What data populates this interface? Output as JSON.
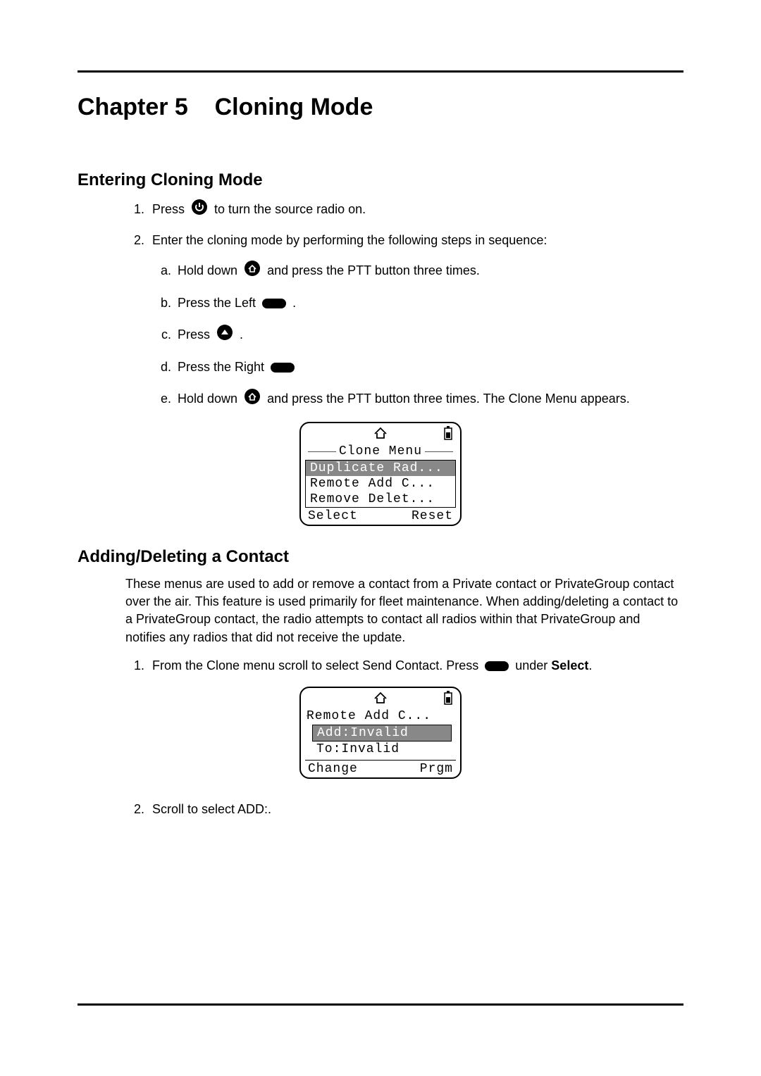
{
  "chapter": {
    "label": "Chapter 5",
    "title": "Cloning Mode"
  },
  "section1": {
    "heading": "Entering Cloning Mode",
    "step1_a": "Press",
    "step1_b": "to turn the source radio on.",
    "step2": "Enter the cloning mode by performing the following steps in sequence:",
    "sub_a_1": "Hold down",
    "sub_a_2": "and press the PTT button three times.",
    "sub_b_1": "Press the Left",
    "sub_b_2": ".",
    "sub_c_1": "Press",
    "sub_c_2": ".",
    "sub_d_1": "Press the Right",
    "sub_e_1": "Hold down",
    "sub_e_2": "and press the PTT button three times. The Clone Menu appears."
  },
  "lcd1": {
    "title": "Clone Menu",
    "items": [
      "Duplicate Rad...",
      "Remote Add C...",
      "Remove Delet..."
    ],
    "soft_left": "Select",
    "soft_right": "Reset"
  },
  "section2": {
    "heading": "Adding/Deleting a Contact",
    "paragraph": "These menus are used to add or remove a contact from a Private contact or PrivateGroup contact over the air. This feature is used primarily for fleet maintenance. When adding/deleting a contact to a PrivateGroup contact, the radio attempts to contact all radios within that PrivateGroup and notifies any radios that did not receive the update.",
    "step1_a": "From the Clone menu scroll to select Send Contact. Press",
    "step1_b": "under",
    "step1_c": "Select",
    "step1_d": ".",
    "step2": "Scroll to select ADD:."
  },
  "lcd2": {
    "title": "Remote Add C...",
    "row_sel": "Add:Invalid",
    "row2": "To:Invalid",
    "soft_left": "Change",
    "soft_right": "Prgm"
  }
}
